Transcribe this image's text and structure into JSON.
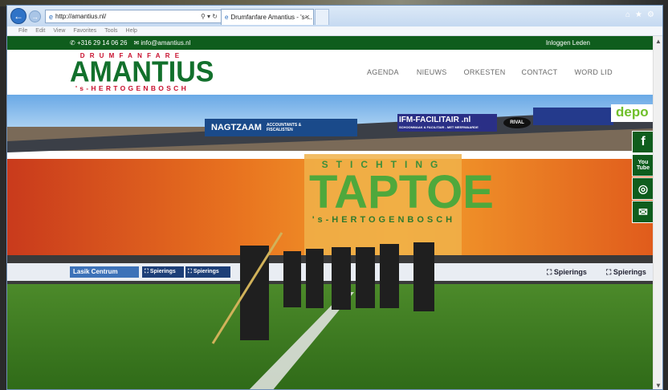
{
  "browser": {
    "address": "http://amantius.nl/",
    "tab_title": "Drumfanfare Amantius - 's-...",
    "menu": [
      "File",
      "Edit",
      "View",
      "Favorites",
      "Tools",
      "Help"
    ]
  },
  "topbar": {
    "phone": "+316 29 14 06 26",
    "email": "info@amantius.nl",
    "login": "Inloggen Leden"
  },
  "logo": {
    "line1": "DRUMFANFARE",
    "line2": "AMANTIUS",
    "line3": "'s-HERTOGENBOSCH"
  },
  "nav": [
    "AGENDA",
    "NIEUWS",
    "ORKESTEN",
    "CONTACT",
    "WORD LID"
  ],
  "social": [
    "facebook-icon",
    "youtube-icon",
    "instagram-icon",
    "mail-icon"
  ],
  "hero": {
    "sponsor_top": [
      "NAGTZAAM",
      "ACCOUNTANTS & FISCALISTEN",
      "IFM-FACILITAIR .nl",
      "RIVAL",
      "depo"
    ],
    "sponsor_sub": "SCHOONMAAK & FACILITAIR - MET MEERWAARDE",
    "banner_small": "STICHTING",
    "banner_big": "TAPTOE",
    "banner_sub": "'s-HERTOGENBOSCH",
    "board_left": "Lasik Centrum",
    "board_sp1": "Spierings",
    "board_sp2": "Spierings",
    "board_sp3": "Spierings",
    "board_sp4": "Spierings"
  },
  "colors": {
    "brand_green": "#0f5d1d",
    "brand_red": "#c8102e"
  }
}
